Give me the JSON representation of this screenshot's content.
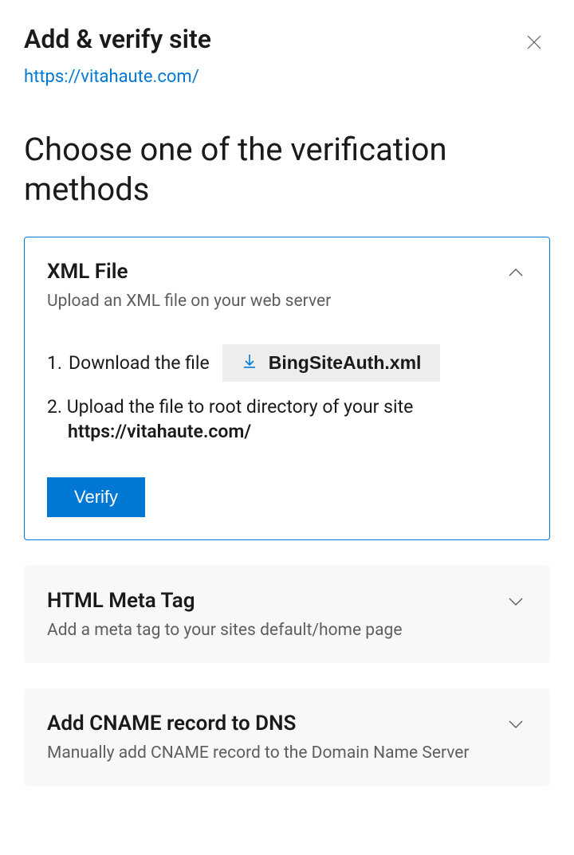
{
  "header": {
    "title": "Add & verify site",
    "site_url": "https://vitahaute.com/"
  },
  "section_heading": "Choose one of the verification methods",
  "methods": {
    "xml": {
      "title": "XML File",
      "subtitle": "Upload an XML file on your web server",
      "step1_num": "1.",
      "step1_text": "Download the file",
      "download_filename": "BingSiteAuth.xml",
      "step2_num": "2.",
      "step2_text": "Upload the file to root directory of your site",
      "step2_url": "https://vitahaute.com/",
      "verify_label": "Verify"
    },
    "meta": {
      "title": "HTML Meta Tag",
      "subtitle": "Add a meta tag to your sites default/home page"
    },
    "cname": {
      "title": "Add CNAME record to DNS",
      "subtitle": "Manually add CNAME record to the Domain Name Server"
    }
  }
}
